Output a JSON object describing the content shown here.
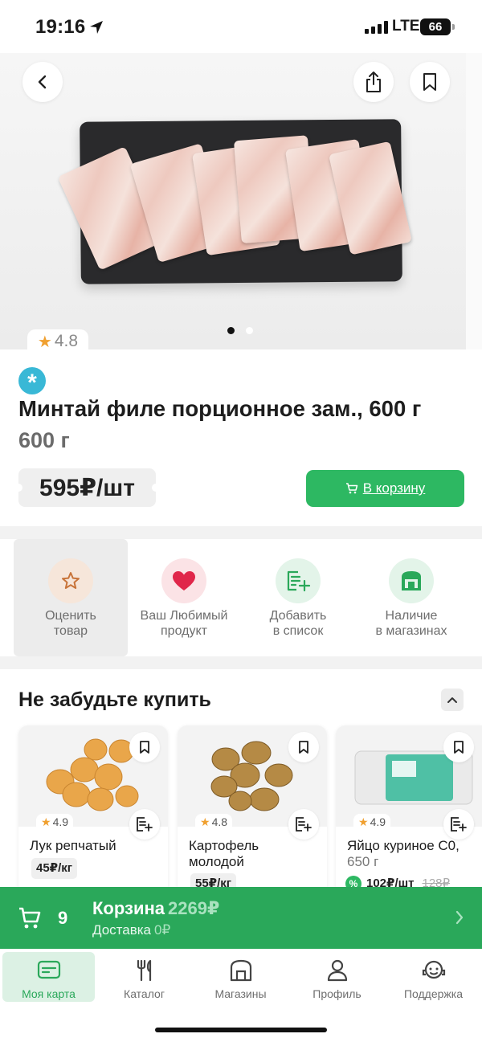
{
  "status_bar": {
    "time": "19:16",
    "network": "LTE",
    "battery": "66"
  },
  "product": {
    "rating": "4.8",
    "title": "Минтай филе порционное зам., 600 г",
    "weight": "600 г",
    "price": "595₽/шт",
    "add_to_cart": "В корзину",
    "image_pages": 2,
    "active_page": 1
  },
  "actions": [
    {
      "label": "Оценить\nтовар"
    },
    {
      "label": "Ваш Любимый\nпродукт"
    },
    {
      "label": "Добавить\nв список"
    },
    {
      "label": "Наличие\nв магазинах"
    }
  ],
  "recommendations": {
    "title": "Не забудьте купить",
    "items": [
      {
        "name": "Лук репчатый",
        "rating": "4.9",
        "price": "45₽/кг"
      },
      {
        "name": "Картофель молодой",
        "rating": "4.8",
        "price": "55₽/кг"
      },
      {
        "name": "Яйцо куриное С0,",
        "sub": "650 г",
        "rating": "4.9",
        "price": "102₽/шт",
        "old_price": "128₽",
        "discount_icon": "%"
      }
    ]
  },
  "cart": {
    "count": "9",
    "label": "Корзина",
    "total": "2269₽",
    "delivery_label": "Доставка",
    "delivery_value": "0₽"
  },
  "tabs": [
    {
      "label": "Моя карта",
      "active": true
    },
    {
      "label": "Каталог"
    },
    {
      "label": "Магазины"
    },
    {
      "label": "Профиль"
    },
    {
      "label": "Поддержка"
    }
  ],
  "colors": {
    "accent": "#2db862",
    "cart_bar": "#2aa85a",
    "star": "#f0a030",
    "frozen_badge": "#39b8d6"
  }
}
